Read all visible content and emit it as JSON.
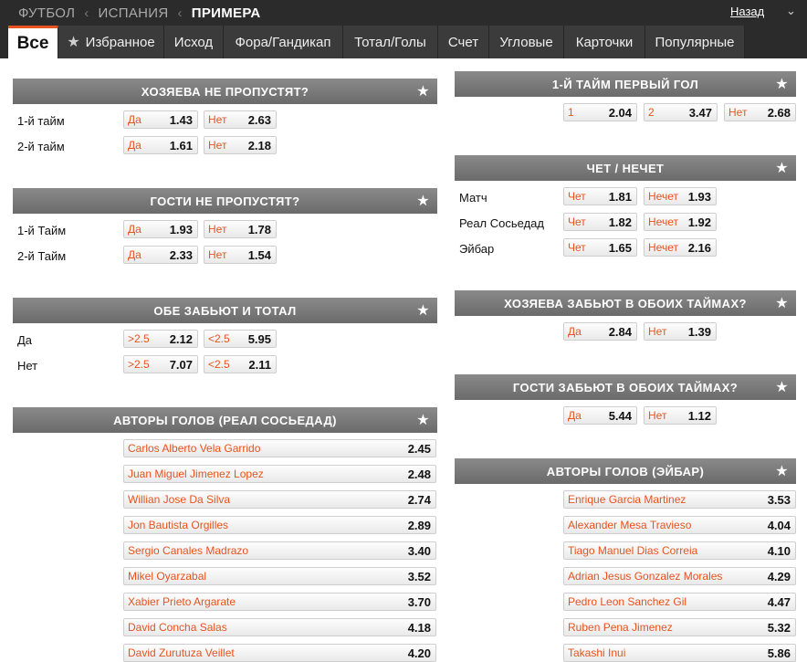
{
  "breadcrumb": [
    "ФУТБОЛ",
    "ИСПАНИЯ",
    "ПРИМЕРА"
  ],
  "back_label": "Назад",
  "tabs": [
    "Все",
    "Избранное",
    "Исход",
    "Фора/Гандикап",
    "Тотал/Голы",
    "Счет",
    "Угловые",
    "Карточки",
    "Популярные"
  ],
  "accent_color": "#e8531f",
  "left": {
    "home_clean": {
      "title": "ХОЗЯЕВА НЕ ПРОПУСТЯТ?",
      "rows": [
        {
          "label": "1-й тайм",
          "odds": [
            {
              "l": "Да",
              "v": "1.43"
            },
            {
              "l": "Нет",
              "v": "2.63"
            }
          ]
        },
        {
          "label": "2-й тайм",
          "odds": [
            {
              "l": "Да",
              "v": "1.61"
            },
            {
              "l": "Нет",
              "v": "2.18"
            }
          ]
        }
      ]
    },
    "away_clean": {
      "title": "ГОСТИ НЕ ПРОПУСТЯТ?",
      "rows": [
        {
          "label": "1-й Тайм",
          "odds": [
            {
              "l": "Да",
              "v": "1.93"
            },
            {
              "l": "Нет",
              "v": "1.78"
            }
          ]
        },
        {
          "label": "2-й Тайм",
          "odds": [
            {
              "l": "Да",
              "v": "2.33"
            },
            {
              "l": "Нет",
              "v": "1.54"
            }
          ]
        }
      ]
    },
    "btts_total": {
      "title": "ОБЕ ЗАБЬЮТ И ТОТАЛ",
      "rows": [
        {
          "label": "Да",
          "odds": [
            {
              "l": ">2.5",
              "v": "2.12"
            },
            {
              "l": "<2.5",
              "v": "5.95"
            }
          ]
        },
        {
          "label": "Нет",
          "odds": [
            {
              "l": ">2.5",
              "v": "7.07"
            },
            {
              "l": "<2.5",
              "v": "2.11"
            }
          ]
        }
      ]
    },
    "scorers": {
      "title": "АВТОРЫ ГОЛОВ (РЕАЛ СОСЬЕДАД)",
      "items": [
        {
          "l": "Carlos Alberto Vela Garrido",
          "v": "2.45"
        },
        {
          "l": "Juan Miguel Jimenez Lopez",
          "v": "2.48"
        },
        {
          "l": "Willian Jose Da Silva",
          "v": "2.74"
        },
        {
          "l": "Jon Bautista Orgilles",
          "v": "2.89"
        },
        {
          "l": "Sergio Canales Madrazo",
          "v": "3.40"
        },
        {
          "l": "Mikel Oyarzabal",
          "v": "3.52"
        },
        {
          "l": "Xabier Prieto Argarate",
          "v": "3.70"
        },
        {
          "l": "David Concha Salas",
          "v": "4.18"
        },
        {
          "l": "David Zurutuza Veillet",
          "v": "4.20"
        }
      ]
    }
  },
  "right": {
    "first_goal": {
      "title": "1-Й ТАЙМ ПЕРВЫЙ ГОЛ",
      "odds": [
        {
          "l": "1",
          "v": "2.04"
        },
        {
          "l": "2",
          "v": "3.47"
        },
        {
          "l": "Нет",
          "v": "2.68"
        }
      ]
    },
    "odd_even": {
      "title": "ЧЕТ / НЕЧЕТ",
      "rows": [
        {
          "label": "Матч",
          "odds": [
            {
              "l": "Чет",
              "v": "1.81"
            },
            {
              "l": "Нечет",
              "v": "1.93"
            }
          ]
        },
        {
          "label": "Реал Сосьедад",
          "odds": [
            {
              "l": "Чет",
              "v": "1.82"
            },
            {
              "l": "Нечет",
              "v": "1.92"
            }
          ]
        },
        {
          "label": "Эйбар",
          "odds": [
            {
              "l": "Чет",
              "v": "1.65"
            },
            {
              "l": "Нечет",
              "v": "2.16"
            }
          ]
        }
      ]
    },
    "home_both_halves": {
      "title": "ХОЗЯЕВА ЗАБЬЮТ В ОБОИХ ТАЙМАХ?",
      "odds": [
        {
          "l": "Да",
          "v": "2.84"
        },
        {
          "l": "Нет",
          "v": "1.39"
        }
      ]
    },
    "away_both_halves": {
      "title": "ГОСТИ ЗАБЬЮТ В ОБОИХ ТАЙМАХ?",
      "odds": [
        {
          "l": "Да",
          "v": "5.44"
        },
        {
          "l": "Нет",
          "v": "1.12"
        }
      ]
    },
    "scorers": {
      "title": "АВТОРЫ ГОЛОВ (ЭЙБАР)",
      "items": [
        {
          "l": "Enrique Garcia Martinez",
          "v": "3.53"
        },
        {
          "l": "Alexander Mesa Travieso",
          "v": "4.04"
        },
        {
          "l": "Tiago Manuel Dias Correia",
          "v": "4.10"
        },
        {
          "l": "Adrian Jesus Gonzalez Morales",
          "v": "4.29"
        },
        {
          "l": "Pedro Leon Sanchez Gil",
          "v": "4.47"
        },
        {
          "l": "Ruben Pena Jimenez",
          "v": "5.32"
        },
        {
          "l": "Takashi Inui",
          "v": "5.86"
        }
      ]
    }
  }
}
